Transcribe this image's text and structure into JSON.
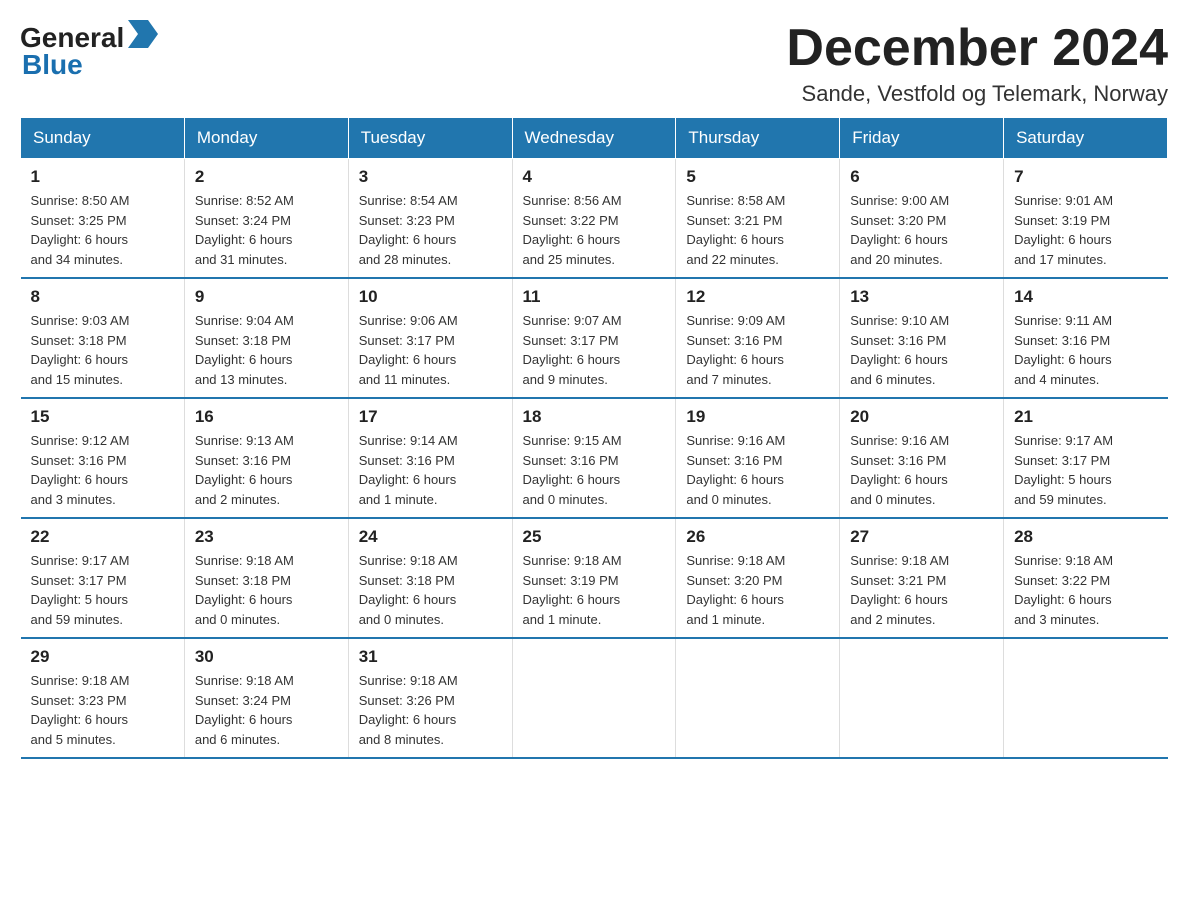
{
  "header": {
    "logo_general": "General",
    "logo_blue": "Blue",
    "title": "December 2024",
    "subtitle": "Sande, Vestfold og Telemark, Norway"
  },
  "days_of_week": [
    "Sunday",
    "Monday",
    "Tuesday",
    "Wednesday",
    "Thursday",
    "Friday",
    "Saturday"
  ],
  "weeks": [
    [
      {
        "day": "1",
        "info": "Sunrise: 8:50 AM\nSunset: 3:25 PM\nDaylight: 6 hours\nand 34 minutes."
      },
      {
        "day": "2",
        "info": "Sunrise: 8:52 AM\nSunset: 3:24 PM\nDaylight: 6 hours\nand 31 minutes."
      },
      {
        "day": "3",
        "info": "Sunrise: 8:54 AM\nSunset: 3:23 PM\nDaylight: 6 hours\nand 28 minutes."
      },
      {
        "day": "4",
        "info": "Sunrise: 8:56 AM\nSunset: 3:22 PM\nDaylight: 6 hours\nand 25 minutes."
      },
      {
        "day": "5",
        "info": "Sunrise: 8:58 AM\nSunset: 3:21 PM\nDaylight: 6 hours\nand 22 minutes."
      },
      {
        "day": "6",
        "info": "Sunrise: 9:00 AM\nSunset: 3:20 PM\nDaylight: 6 hours\nand 20 minutes."
      },
      {
        "day": "7",
        "info": "Sunrise: 9:01 AM\nSunset: 3:19 PM\nDaylight: 6 hours\nand 17 minutes."
      }
    ],
    [
      {
        "day": "8",
        "info": "Sunrise: 9:03 AM\nSunset: 3:18 PM\nDaylight: 6 hours\nand 15 minutes."
      },
      {
        "day": "9",
        "info": "Sunrise: 9:04 AM\nSunset: 3:18 PM\nDaylight: 6 hours\nand 13 minutes."
      },
      {
        "day": "10",
        "info": "Sunrise: 9:06 AM\nSunset: 3:17 PM\nDaylight: 6 hours\nand 11 minutes."
      },
      {
        "day": "11",
        "info": "Sunrise: 9:07 AM\nSunset: 3:17 PM\nDaylight: 6 hours\nand 9 minutes."
      },
      {
        "day": "12",
        "info": "Sunrise: 9:09 AM\nSunset: 3:16 PM\nDaylight: 6 hours\nand 7 minutes."
      },
      {
        "day": "13",
        "info": "Sunrise: 9:10 AM\nSunset: 3:16 PM\nDaylight: 6 hours\nand 6 minutes."
      },
      {
        "day": "14",
        "info": "Sunrise: 9:11 AM\nSunset: 3:16 PM\nDaylight: 6 hours\nand 4 minutes."
      }
    ],
    [
      {
        "day": "15",
        "info": "Sunrise: 9:12 AM\nSunset: 3:16 PM\nDaylight: 6 hours\nand 3 minutes."
      },
      {
        "day": "16",
        "info": "Sunrise: 9:13 AM\nSunset: 3:16 PM\nDaylight: 6 hours\nand 2 minutes."
      },
      {
        "day": "17",
        "info": "Sunrise: 9:14 AM\nSunset: 3:16 PM\nDaylight: 6 hours\nand 1 minute."
      },
      {
        "day": "18",
        "info": "Sunrise: 9:15 AM\nSunset: 3:16 PM\nDaylight: 6 hours\nand 0 minutes."
      },
      {
        "day": "19",
        "info": "Sunrise: 9:16 AM\nSunset: 3:16 PM\nDaylight: 6 hours\nand 0 minutes."
      },
      {
        "day": "20",
        "info": "Sunrise: 9:16 AM\nSunset: 3:16 PM\nDaylight: 6 hours\nand 0 minutes."
      },
      {
        "day": "21",
        "info": "Sunrise: 9:17 AM\nSunset: 3:17 PM\nDaylight: 5 hours\nand 59 minutes."
      }
    ],
    [
      {
        "day": "22",
        "info": "Sunrise: 9:17 AM\nSunset: 3:17 PM\nDaylight: 5 hours\nand 59 minutes."
      },
      {
        "day": "23",
        "info": "Sunrise: 9:18 AM\nSunset: 3:18 PM\nDaylight: 6 hours\nand 0 minutes."
      },
      {
        "day": "24",
        "info": "Sunrise: 9:18 AM\nSunset: 3:18 PM\nDaylight: 6 hours\nand 0 minutes."
      },
      {
        "day": "25",
        "info": "Sunrise: 9:18 AM\nSunset: 3:19 PM\nDaylight: 6 hours\nand 1 minute."
      },
      {
        "day": "26",
        "info": "Sunrise: 9:18 AM\nSunset: 3:20 PM\nDaylight: 6 hours\nand 1 minute."
      },
      {
        "day": "27",
        "info": "Sunrise: 9:18 AM\nSunset: 3:21 PM\nDaylight: 6 hours\nand 2 minutes."
      },
      {
        "day": "28",
        "info": "Sunrise: 9:18 AM\nSunset: 3:22 PM\nDaylight: 6 hours\nand 3 minutes."
      }
    ],
    [
      {
        "day": "29",
        "info": "Sunrise: 9:18 AM\nSunset: 3:23 PM\nDaylight: 6 hours\nand 5 minutes."
      },
      {
        "day": "30",
        "info": "Sunrise: 9:18 AM\nSunset: 3:24 PM\nDaylight: 6 hours\nand 6 minutes."
      },
      {
        "day": "31",
        "info": "Sunrise: 9:18 AM\nSunset: 3:26 PM\nDaylight: 6 hours\nand 8 minutes."
      },
      null,
      null,
      null,
      null
    ]
  ]
}
